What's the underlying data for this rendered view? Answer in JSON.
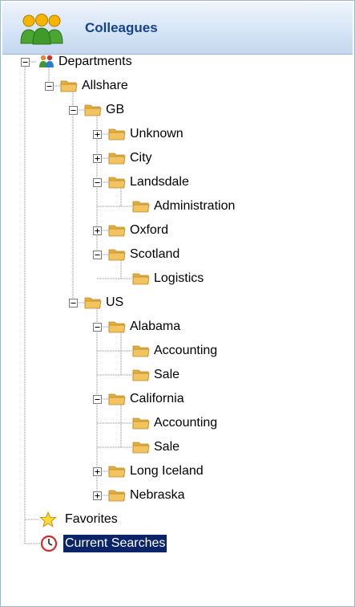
{
  "panel": {
    "title": "Colleagues",
    "icon": "people-icon"
  },
  "tree": {
    "root": {
      "label": "Departments",
      "children": [
        {
          "label": "Allshare",
          "children": [
            {
              "label": "GB",
              "children": [
                {
                  "label": "Unknown",
                  "state": "collapsed"
                },
                {
                  "label": "City",
                  "state": "collapsed"
                },
                {
                  "label": "Landsdale",
                  "state": "expanded",
                  "children": [
                    {
                      "label": "Administration"
                    }
                  ]
                },
                {
                  "label": "Oxford",
                  "state": "collapsed"
                },
                {
                  "label": "Scotland",
                  "state": "expanded",
                  "children": [
                    {
                      "label": "Logistics"
                    }
                  ]
                }
              ]
            },
            {
              "label": "US",
              "children": [
                {
                  "label": "Alabama",
                  "state": "expanded",
                  "children": [
                    {
                      "label": "Accounting"
                    },
                    {
                      "label": "Sale"
                    }
                  ]
                },
                {
                  "label": "California",
                  "state": "expanded",
                  "children": [
                    {
                      "label": "Accounting"
                    },
                    {
                      "label": "Sale"
                    }
                  ]
                },
                {
                  "label": "Long Iceland",
                  "state": "collapsed"
                },
                {
                  "label": "Nebraska",
                  "state": "collapsed"
                }
              ]
            }
          ]
        }
      ]
    },
    "favorites": {
      "label": "Favorites",
      "icon": "star-icon"
    },
    "current_searches": {
      "label": "Current Searches",
      "icon": "clock-icon",
      "selected": true
    }
  },
  "colors": {
    "header_text": "#15428b",
    "selection_bg": "#0a246a",
    "selection_text": "#ffffff",
    "folder": "#f2c460"
  }
}
